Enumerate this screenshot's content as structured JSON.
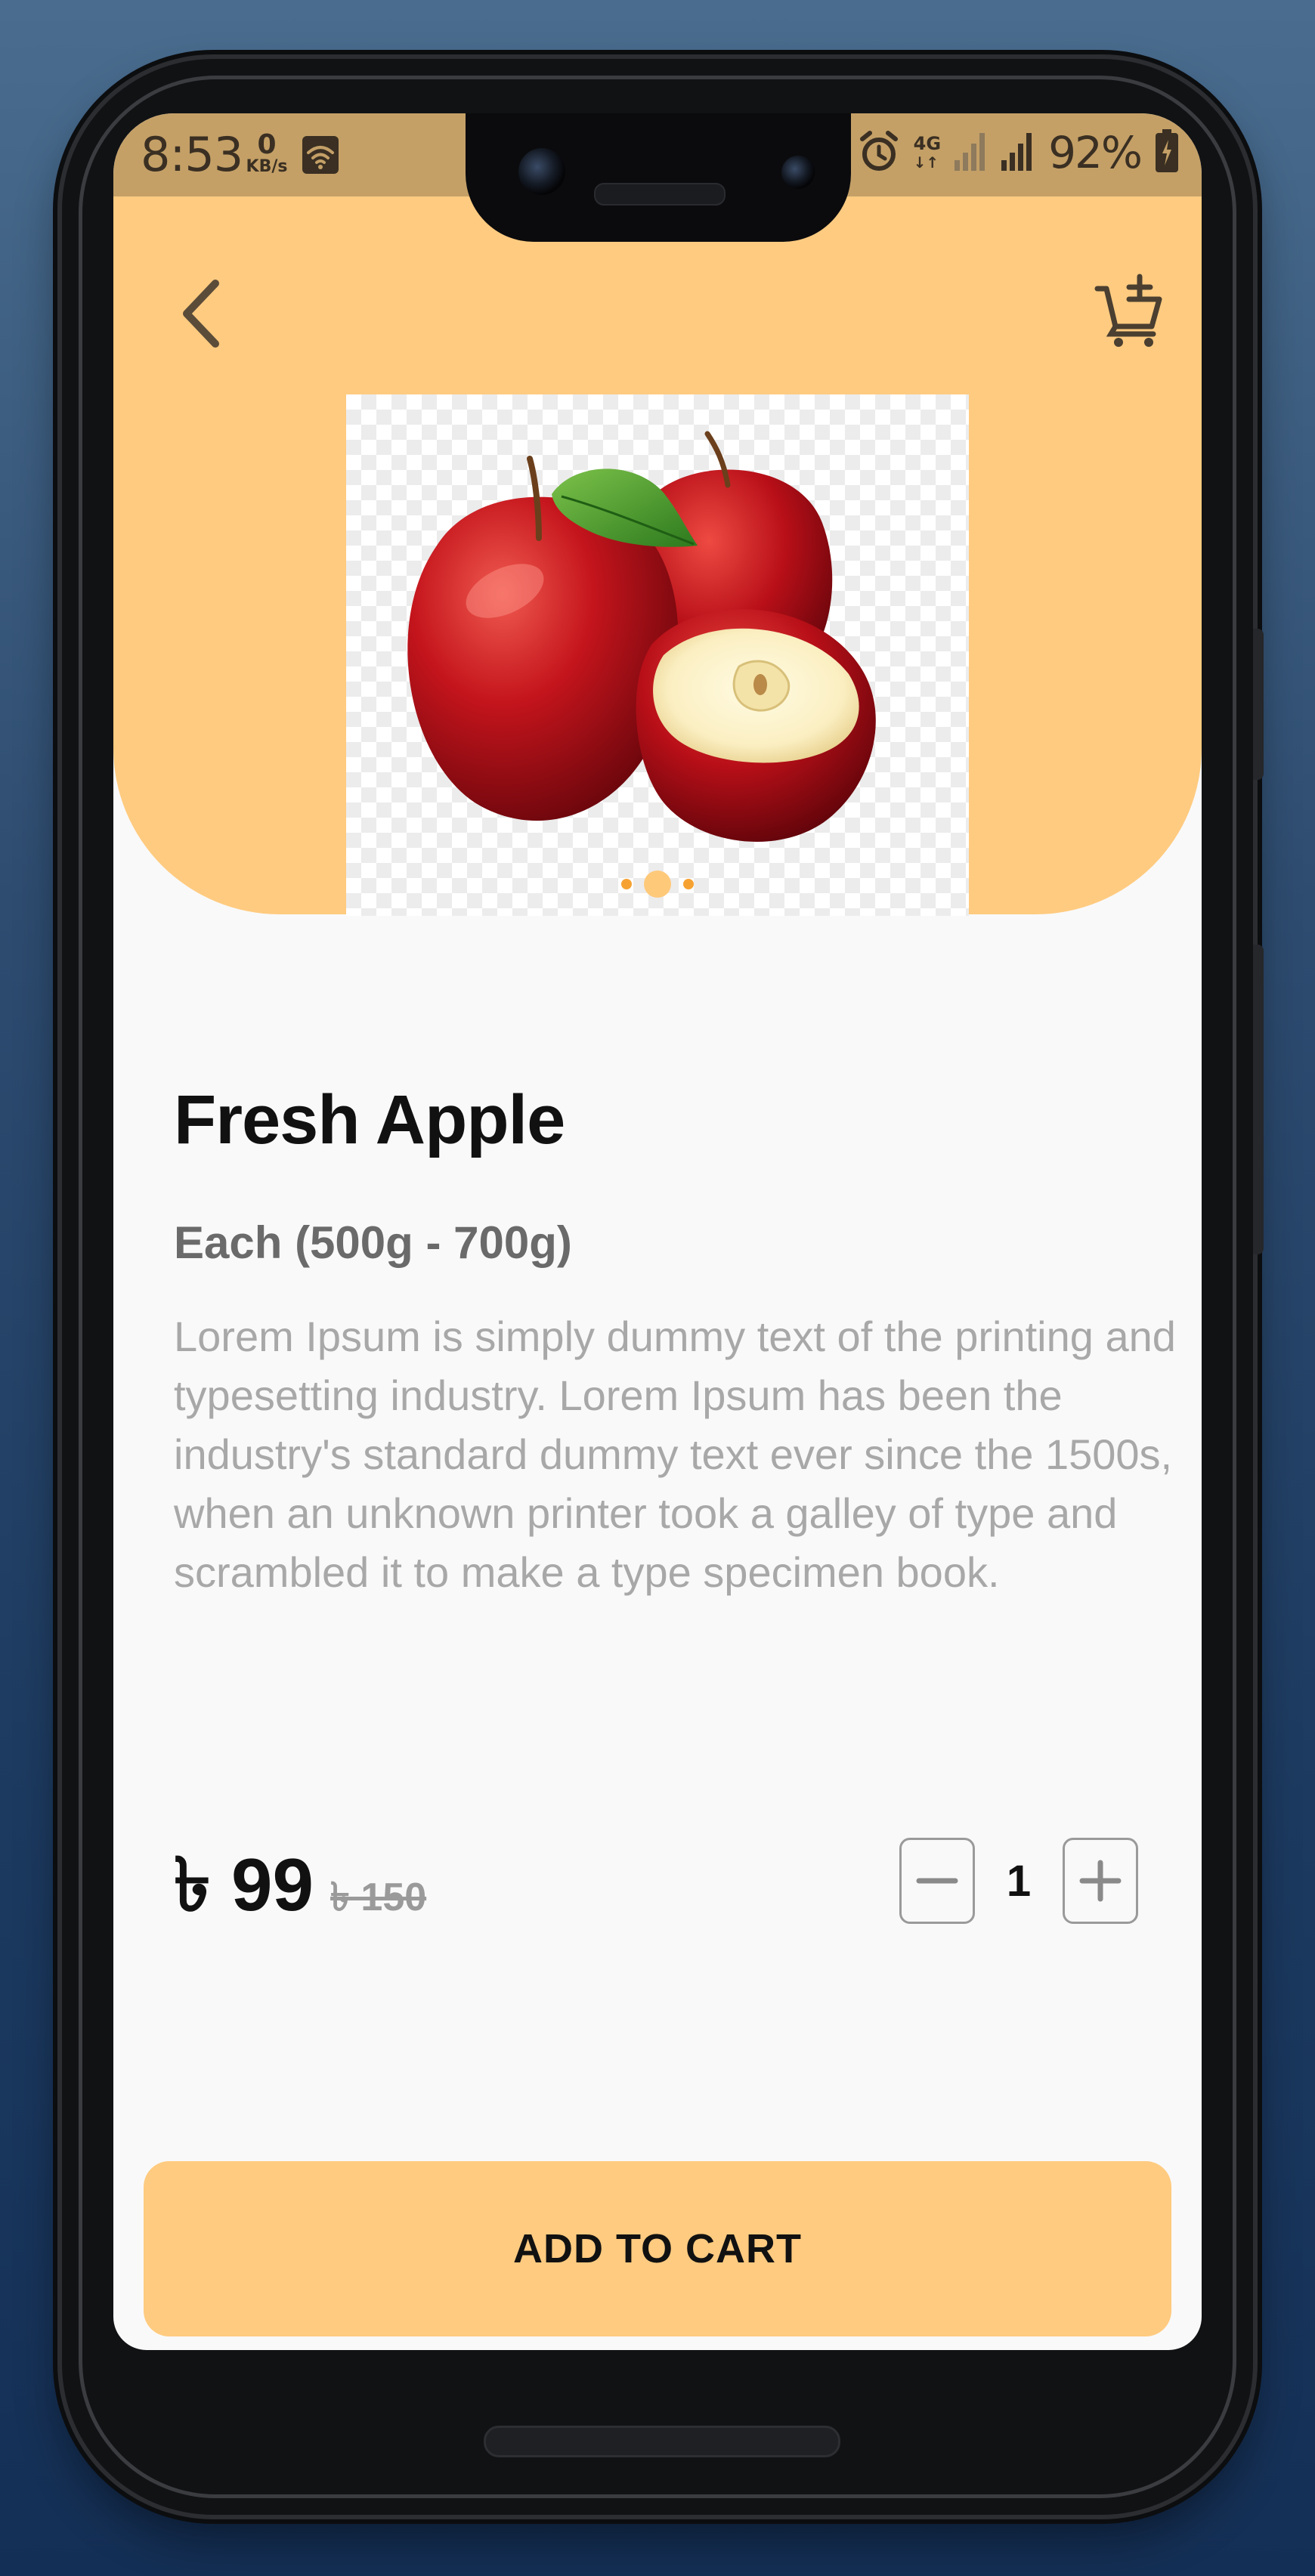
{
  "status_bar": {
    "time": "8:53",
    "net_speed_value": "0",
    "net_speed_unit": "KB/s",
    "network_type": "4G",
    "battery_percent": "92%"
  },
  "header": {
    "back_icon": "chevron-left-icon",
    "cart_icon": "cart-add-icon"
  },
  "product": {
    "image_alt": "Fresh red apples",
    "carousel_count": 3,
    "carousel_active_index": 1,
    "title": "Fresh Apple",
    "size": "Each (500g - 700g)",
    "description": "Lorem Ipsum is simply dummy text of the printing and typesetting industry. Lorem Ipsum has been the industry's standard dummy text ever since the 1500s, when an unknown printer took a galley of type and scrambled it to make a type specimen book.",
    "price_current": "৳ 99",
    "price_old": "৳ 150",
    "quantity": "1"
  },
  "actions": {
    "add_to_cart_label": "ADD TO CART"
  },
  "colors": {
    "accent": "#ffcb80",
    "status_bar": "#c4a067",
    "carousel_dot": "#f6a233",
    "background": "#f9f9f9",
    "text_primary": "#111111",
    "text_muted": "#a8a8a8"
  }
}
